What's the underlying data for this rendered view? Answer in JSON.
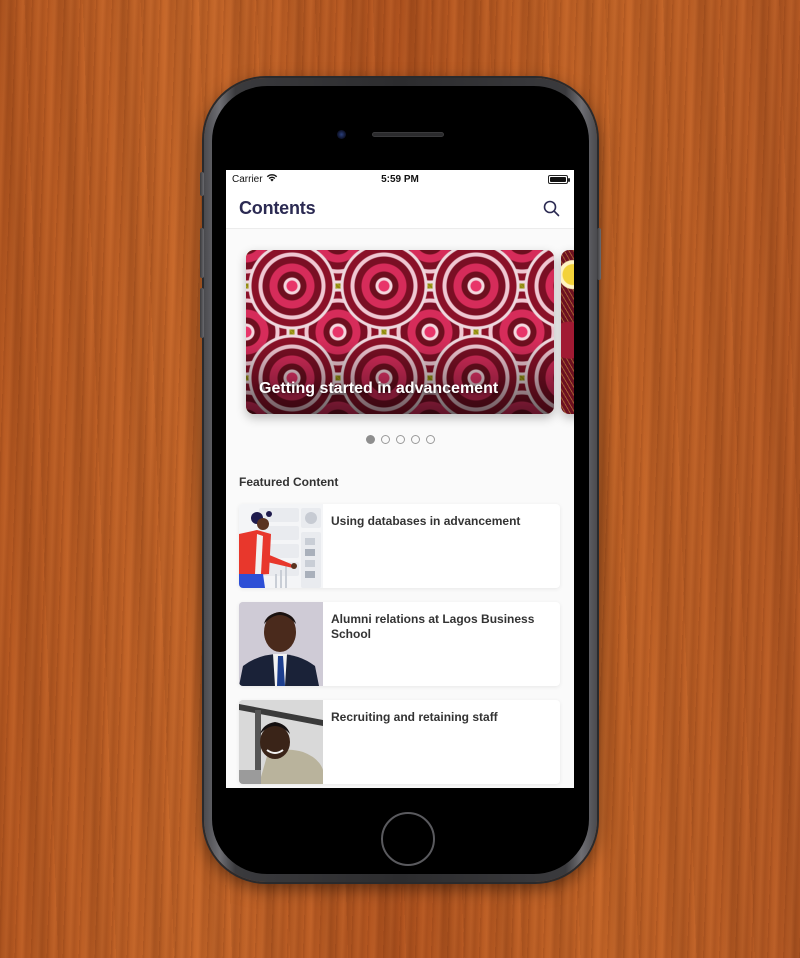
{
  "status_bar": {
    "carrier": "Carrier",
    "time": "5:59 PM",
    "battery_level": 1.0
  },
  "nav": {
    "title": "Contents",
    "search_icon": "search-icon"
  },
  "carousel": {
    "slides": [
      {
        "title": "Getting started in advancement"
      },
      {
        "title": ""
      }
    ],
    "page_count": 5,
    "active_page": 1
  },
  "featured": {
    "heading": "Featured Content",
    "items": [
      {
        "title": "Using databases in advancement",
        "thumbnail": "illustration-woman-presenting-dashboard"
      },
      {
        "title": "Alumni relations at Lagos Business School",
        "thumbnail": "portrait-man-in-suit"
      },
      {
        "title": "Recruiting and retaining staff",
        "thumbnail": "photo-smiling-man"
      }
    ]
  },
  "colors": {
    "title_color": "#2b2a52",
    "text_color": "#333333",
    "screen_bg": "#fafafa"
  }
}
